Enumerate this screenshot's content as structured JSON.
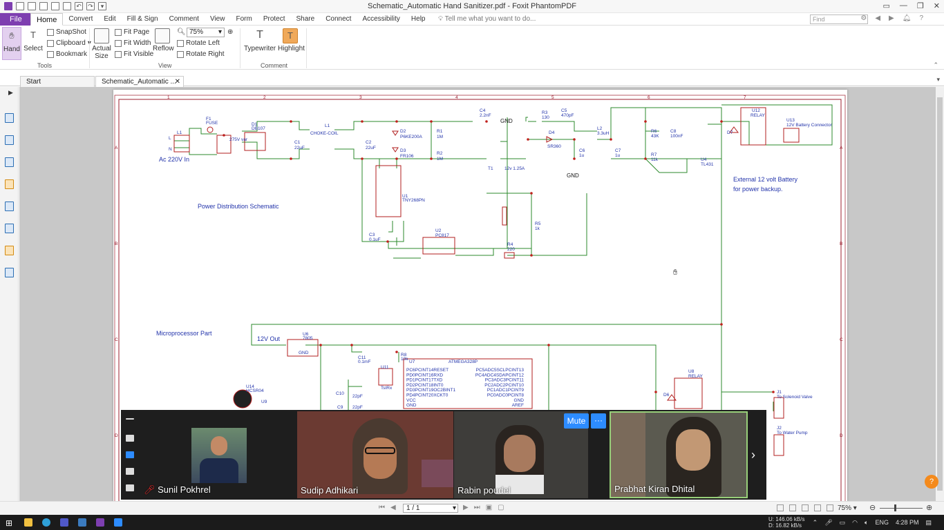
{
  "window": {
    "title": "Schematic_Automatic Hand Sanitizer.pdf - Foxit PhantomPDF"
  },
  "menu": {
    "file": "File",
    "items": [
      "Home",
      "Convert",
      "Edit",
      "Fill & Sign",
      "Comment",
      "View",
      "Form",
      "Protect",
      "Share",
      "Connect",
      "Accessibility",
      "Help"
    ],
    "tell_me": "Tell me what you want to do...",
    "find_placeholder": "Find"
  },
  "ribbon": {
    "hand": "Hand",
    "select": "Select",
    "snapshot": "SnapShot",
    "clipboard": "Clipboard",
    "bookmark": "Bookmark",
    "actual_size_1": "Actual",
    "actual_size_2": "Size",
    "fit_page": "Fit Page",
    "fit_width": "Fit Width",
    "fit_visible": "Fit Visible",
    "reflow": "Reflow",
    "zoom": "75%",
    "rotate_left": "Rotate Left",
    "rotate_right": "Rotate Right",
    "typewriter": "Typewriter",
    "highlight": "Highlight",
    "group_tools": "Tools",
    "group_view": "View",
    "group_comment": "Comment"
  },
  "tabs": {
    "start": "Start",
    "doc": "Schematic_Automatic ..."
  },
  "schematic": {
    "power_title": "Power Distribution Schematic",
    "micro_title": "Microprocessor Part",
    "ac_in": "Ac 220V In",
    "out_12v": "12V Out",
    "battery_note_1": "External 12 volt Battery",
    "battery_note_2": "for power backup.",
    "gnd": "GND",
    "col_numbers": [
      "1",
      "2",
      "3",
      "4",
      "5",
      "6",
      "7"
    ],
    "row_letters": [
      "A",
      "B",
      "C",
      "D"
    ],
    "parts": {
      "f1": "F1",
      "fuse": "FUSE",
      "var": "275V var",
      "d1": "D1",
      "db107": "DB107",
      "l1": "L1",
      "choke": "CHOKE-COIL",
      "c1": "C1",
      "c1v": "22uF",
      "c2": "C2",
      "c2v": "22uF",
      "d2": "D2",
      "d2v": "P6KE200A",
      "d3": "D3",
      "d3v": "FR106",
      "r1": "R1",
      "r1v": "1M",
      "r2": "R2",
      "r2v": "1M",
      "c4": "C4",
      "c4v": "2.2nF",
      "t1": "T1",
      "t1v": "12v 1.25A",
      "r3": "R3",
      "r3v": "130",
      "c5": "C5",
      "c5v": "470pF",
      "d4": "D4",
      "d4v": "SR360",
      "c6": "C6",
      "c6v": "1u",
      "l2": "L2",
      "l2v": "3.3uH",
      "c7": "C7",
      "c7v": "1u",
      "r6": "R6",
      "r6v": "43K",
      "c8": "C8",
      "c8v": "100nF",
      "r7": "R7",
      "r7v": "11k",
      "u4": "U4",
      "u4v": "TL431",
      "u12": "U12",
      "relay": "RELAY",
      "d7": "D7",
      "u13": "U13",
      "u13v": "12V Battery Connector",
      "u1": "U1",
      "u1v": "TNY268PN",
      "c3": "C3",
      "c3v": "0.1uF",
      "u2": "U2",
      "u2v": "PC817",
      "r4": "R4",
      "r4v": "220",
      "r5": "R5",
      "r5v": "1k",
      "u6": "U6",
      "u6v": "7805",
      "c11": "C11",
      "c11v": "0.1mF",
      "r8": "R8",
      "r8v": "10k",
      "u7": "U7",
      "u7v": "ATMEGA328P",
      "u11": "U11",
      "u11v": "TsIRx",
      "c10": "C10",
      "c10v": "22pF",
      "c9": "C9",
      "c9v": "22pF",
      "u14": "U14",
      "u14v": "HCSR04",
      "u9": "U9",
      "u8": "U8",
      "u8v": "RELAY",
      "d6": "D6",
      "j1": "J1",
      "j1v": "To Solenoid Valve",
      "j2": "J2",
      "j2v": "To Water Pump"
    },
    "mcu_pins_left": [
      "PC6PCINT14RESET",
      "PD0PCINT16RXD",
      "PD1PCINT17TXD",
      "PD2PCINT18INT0",
      "PD3PCINT19OC2BINT1",
      "PD4PCINT20XCKT0",
      "VCC",
      "GND"
    ],
    "mcu_pins_right": [
      "PC5ADC5SCLPCINT13",
      "PC4ADC4SDAPCINT12",
      "PC3ADC3PCINT11",
      "PC2ADC2PCINT10",
      "PC1ADC1PCINT9",
      "PC0ADC0PCINT8",
      "GND",
      "AREF"
    ]
  },
  "meeting": {
    "participants": [
      {
        "name": "Sunil Pokhrel",
        "muted": true
      },
      {
        "name": "Sudip Adhikari",
        "muted": false
      },
      {
        "name": "Rabin poudel",
        "muted": false
      },
      {
        "name": "Prabhat Kiran Dhital",
        "muted": false
      }
    ],
    "mute_label": "Mute",
    "more_label": "···"
  },
  "statusbar": {
    "page": "1 / 1",
    "zoom": "75%"
  },
  "taskbar": {
    "net_up": "146.06 kB/s",
    "net_down": "16.82 kB/s",
    "lang": "ENG",
    "time": "4:28 PM"
  },
  "colors": {
    "accent": "#7e3fb0",
    "wire": "#2b8a2b",
    "border": "#9b1c2c",
    "label": "#2233aa",
    "junction": "#c0201c"
  }
}
